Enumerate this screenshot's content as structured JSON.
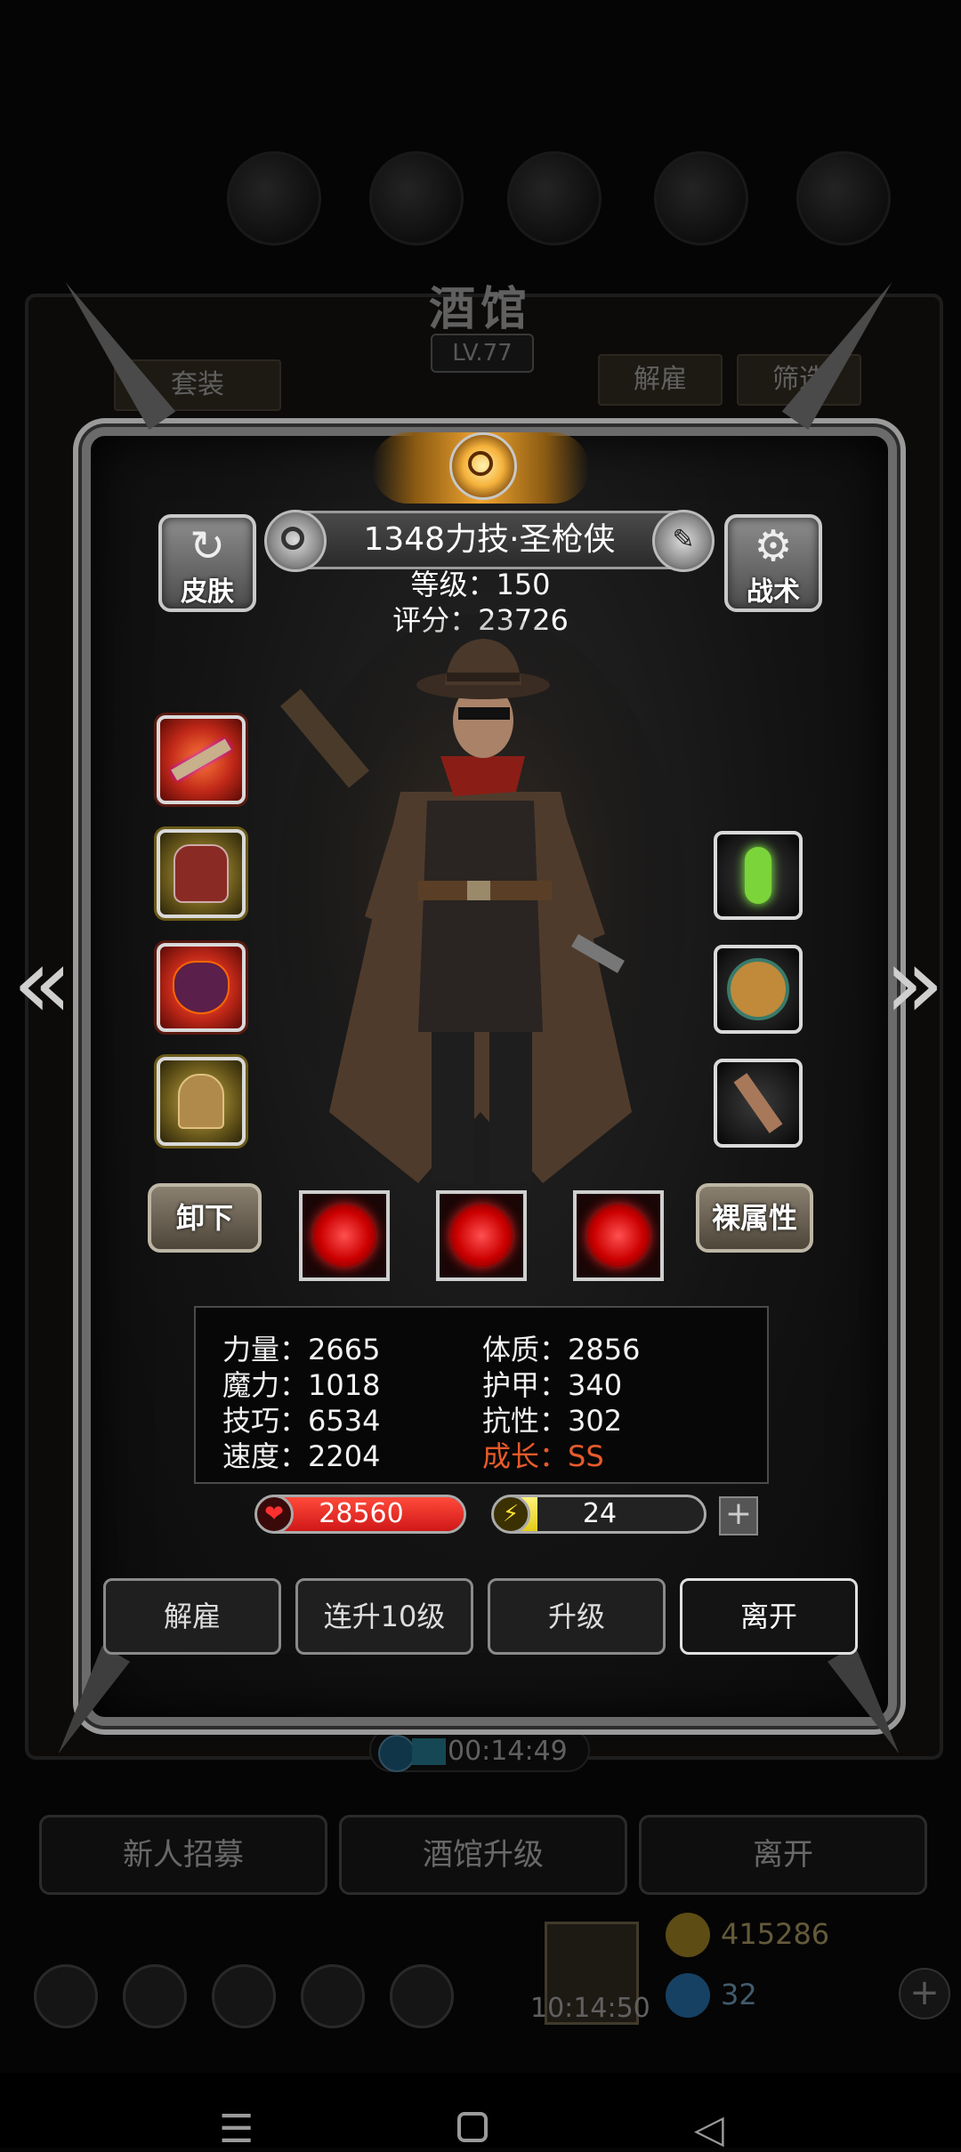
{
  "background": {
    "title": "酒馆",
    "level": "LV.77",
    "btn_set": "套装",
    "btn_dismiss": "解雇",
    "btn_filter": "筛选",
    "timer": "00:14:49",
    "bottom_buttons": [
      "新人招募",
      "酒馆升级",
      "离开"
    ],
    "coins": "415286",
    "gems": "32",
    "clock": "10:14:50"
  },
  "hero": {
    "name": "1348力技·圣枪侠",
    "level_line": "等级：150",
    "score_line": "评分：23726"
  },
  "buttons": {
    "skin": "皮肤",
    "tactics": "战术",
    "unequip": "卸下",
    "base_attr": "裸属性"
  },
  "stats": {
    "strength": "力量：2665",
    "magic": "魔力：1018",
    "skill": "技巧：6534",
    "speed": "速度：2204",
    "constitution": "体质：2856",
    "armor": "护甲：340",
    "resistance": "抗性：302",
    "growth": "成长：SS"
  },
  "bars": {
    "hp_value": "28560",
    "hp_fill": 1.0,
    "energy_value": "24",
    "energy_fill": 0.2,
    "plus": "+"
  },
  "actions": [
    "解雇",
    "连升10级",
    "升级",
    "离开"
  ],
  "icons": {
    "left_slots": [
      "rifle-icon",
      "armor-icon",
      "demon-mask-icon",
      "bell-icon"
    ],
    "right_slots": [
      "green-crystal-icon",
      "pocket-watch-icon",
      "slingshot-icon"
    ],
    "skills": [
      "crosshair-skill-icon",
      "vortex-skill-icon",
      "target-skill-icon"
    ]
  },
  "colors": {
    "hp": "#d01818",
    "energy": "#e2cc1a",
    "growth": "#e85a2a",
    "emblem": "#f2a531"
  }
}
